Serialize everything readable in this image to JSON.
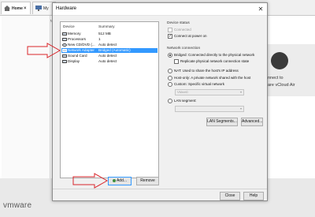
{
  "app": {
    "tabs": [
      {
        "label": "Home",
        "close": "×"
      },
      {
        "label": "My Com"
      }
    ],
    "cloud": {
      "line1": "nnect to",
      "line2": "are vCloud Air"
    },
    "logo": "vmware"
  },
  "dialog": {
    "title": "Hardware",
    "close": "✕",
    "device_list": {
      "headers": {
        "device": "Device",
        "summary": "Summary"
      },
      "rows": [
        {
          "device": "Memory",
          "summary": "512 MB",
          "icon": "memory-icon"
        },
        {
          "device": "Processors",
          "summary": "1",
          "icon": "cpu-icon"
        },
        {
          "device": "New CD/DVD (...",
          "summary": "Auto detect",
          "icon": "cd-dvd-icon"
        },
        {
          "device": "Network Adapter",
          "summary": "Bridged (Automatic)",
          "icon": "network-adapter-icon",
          "selected": true
        },
        {
          "device": "Sound Card",
          "summary": "Auto detect",
          "icon": "sound-card-icon"
        },
        {
          "device": "Display",
          "summary": "Auto detect",
          "icon": "display-icon"
        }
      ]
    },
    "buttons": {
      "add": "Add...",
      "remove": "Remove",
      "close": "Close",
      "help": "Help"
    },
    "device_status": {
      "title": "Device status",
      "connected": "Connected",
      "connect_at_power_on": "Connect at power on",
      "check_mark": "✓"
    },
    "network_connection": {
      "title": "Network connection",
      "bridged": "Bridged: Connected directly to the physical network",
      "replicate": "Replicate physical network connection state",
      "nat": "NAT: Used to share the host's IP address",
      "host_only": "Host-only: A private network shared with the host",
      "custom": "Custom: Specific virtual network",
      "vmnet_value": "VMnet0",
      "lan_segment": "LAN segment:",
      "lan_segments_button": "LAN Segments...",
      "advanced_button": "Advanced..."
    }
  },
  "colors": {
    "selection": "#3399ff",
    "arrow_outline": "#d9262b"
  }
}
